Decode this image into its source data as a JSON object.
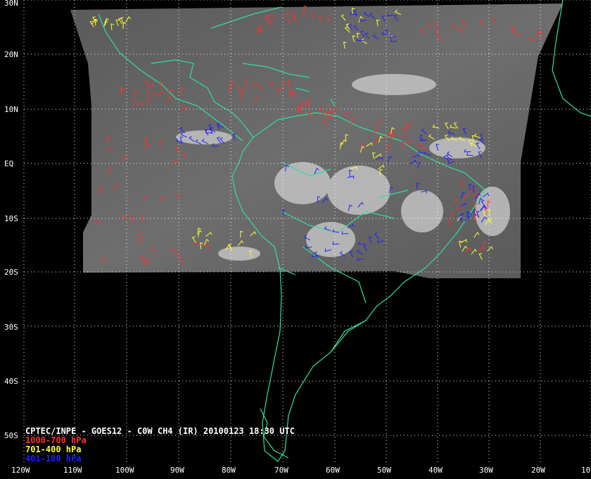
{
  "title": "CPTEC/INPE - GOES12 - C0W CH4 (IR) 20100123 18:30 UTC",
  "legend": [
    {
      "label": "1000-700 hPa",
      "color": "#ff3030"
    },
    {
      "label": "701-400 hPa",
      "color": "#ffff33"
    },
    {
      "label": "401-100 hPa",
      "color": "#2020ff"
    }
  ],
  "latitude_labels": [
    "30N",
    "20N",
    "10N",
    "EQ",
    "10S",
    "20S",
    "30S",
    "40S",
    "50S"
  ],
  "longitude_labels": [
    "120W",
    "110W",
    "100W",
    "90W",
    "80W",
    "70W",
    "60W",
    "50W",
    "40W",
    "30W",
    "20W",
    "10"
  ],
  "colors": {
    "background": "#000000",
    "coastline": "#33dd99",
    "grid": "#ffffff"
  }
}
